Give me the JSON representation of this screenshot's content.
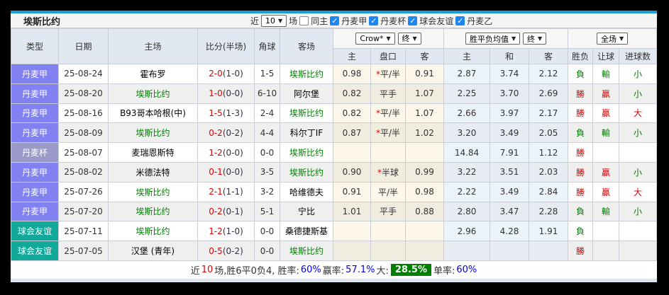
{
  "title": "埃斯比约",
  "filters": {
    "near_label": "近",
    "matches_value": "10",
    "matches_unit": "场",
    "same_home": {
      "label": "同主",
      "checked": false
    },
    "leagues": [
      {
        "label": "丹麦甲",
        "checked": true
      },
      {
        "label": "丹麦杯",
        "checked": true
      },
      {
        "label": "球会友谊",
        "checked": true
      },
      {
        "label": "丹麦乙",
        "checked": true
      }
    ]
  },
  "selectors": {
    "odds_source": "Crow*",
    "odds_time": "终",
    "avg_source": "胜平负均值",
    "avg_time": "终",
    "scope": "全场"
  },
  "columns": {
    "type": "类型",
    "date": "日期",
    "home": "主场",
    "score": "比分(半场)",
    "corner": "角球",
    "away": "客场",
    "h_home": "主",
    "h_line": "盘口",
    "h_away": "客",
    "avg_home": "主",
    "avg_draw": "和",
    "avg_away": "客",
    "res_wdl": "胜负",
    "res_handicap": "让球",
    "res_goals": "进球数"
  },
  "rows": [
    {
      "league": "丹麦甲",
      "league_class": "lg-a",
      "date": "25-08-24",
      "home": "霍布罗",
      "home_focus": false,
      "score": "2-0",
      "half": "(1-0)",
      "corner": "1-5",
      "away": "埃斯比约",
      "away_focus": true,
      "h1": "0.98",
      "star": true,
      "line": "平/半",
      "h2": "0.91",
      "a1": "2.87",
      "a2": "3.74",
      "a3": "2.12",
      "r1": "負",
      "r1c": "green",
      "r2": "輸",
      "r2c": "green",
      "r3": "小",
      "r3c": "green"
    },
    {
      "league": "丹麦甲",
      "league_class": "lg-a",
      "date": "25-08-20",
      "home": "埃斯比约",
      "home_focus": true,
      "score": "1-0",
      "half": "(0-0)",
      "corner": "6-10",
      "away": "阿尔堡",
      "away_focus": false,
      "h1": "0.82",
      "star": false,
      "line": "平手",
      "h2": "1.07",
      "a1": "2.25",
      "a2": "3.70",
      "a3": "2.69",
      "r1": "勝",
      "r1c": "red",
      "r2": "贏",
      "r2c": "red",
      "r3": "小",
      "r3c": "green"
    },
    {
      "league": "丹麦甲",
      "league_class": "lg-a",
      "date": "25-08-16",
      "home": "B93哥本哈根(中)",
      "home_focus": false,
      "score": "1-5",
      "half": "(1-3)",
      "corner": "2-4",
      "away": "埃斯比约",
      "away_focus": true,
      "h1": "0.82",
      "star": true,
      "line": "平/半",
      "h2": "1.07",
      "a1": "2.66",
      "a2": "3.97",
      "a3": "2.17",
      "r1": "勝",
      "r1c": "red",
      "r2": "贏",
      "r2c": "red",
      "r3": "大",
      "r3c": "red"
    },
    {
      "league": "丹麦甲",
      "league_class": "lg-a",
      "date": "25-08-09",
      "home": "埃斯比约",
      "home_focus": true,
      "score": "0-2",
      "half": "(0-2)",
      "corner": "4-4",
      "away": "科尔丁IF",
      "away_focus": false,
      "h1": "0.87",
      "star": true,
      "line": "平/半",
      "h2": "1.02",
      "a1": "3.20",
      "a2": "3.49",
      "a3": "2.05",
      "r1": "負",
      "r1c": "green",
      "r2": "輸",
      "r2c": "green",
      "r3": "小",
      "r3c": "green"
    },
    {
      "league": "丹麦杯",
      "league_class": "lg-cup",
      "date": "25-08-07",
      "home": "麦瑞恩斯特",
      "home_focus": false,
      "score": "1-2",
      "half": "(0-0)",
      "corner": "0-0",
      "away": "埃斯比约",
      "away_focus": true,
      "h1": "",
      "star": false,
      "line": "",
      "h2": "",
      "a1": "14.84",
      "a2": "7.91",
      "a3": "1.12",
      "r1": "勝",
      "r1c": "red",
      "r2": "",
      "r2c": "",
      "r3": "",
      "r3c": ""
    },
    {
      "league": "丹麦甲",
      "league_class": "lg-a",
      "date": "25-08-02",
      "home": "米德法特",
      "home_focus": false,
      "score": "0-1",
      "half": "(0-0)",
      "corner": "3-5",
      "away": "埃斯比约",
      "away_focus": true,
      "h1": "0.90",
      "star": true,
      "line": "半球",
      "h2": "0.99",
      "a1": "3.22",
      "a2": "3.51",
      "a3": "2.03",
      "r1": "勝",
      "r1c": "red",
      "r2": "贏",
      "r2c": "red",
      "r3": "小",
      "r3c": "green"
    },
    {
      "league": "丹麦甲",
      "league_class": "lg-a",
      "date": "25-07-26",
      "home": "埃斯比约",
      "home_focus": true,
      "score": "2-1",
      "half": "(1-1)",
      "corner": "3-2",
      "away": "哈维德夫",
      "away_focus": false,
      "h1": "0.91",
      "star": false,
      "line": "平/半",
      "h2": "0.98",
      "a1": "2.22",
      "a2": "3.49",
      "a3": "2.84",
      "r1": "勝",
      "r1c": "red",
      "r2": "贏",
      "r2c": "red",
      "r3": "大",
      "r3c": "red"
    },
    {
      "league": "丹麦甲",
      "league_class": "lg-a",
      "date": "25-07-20",
      "home": "埃斯比约",
      "home_focus": true,
      "score": "0-2",
      "half": "(0-1)",
      "corner": "5-1",
      "away": "宁比",
      "away_focus": false,
      "h1": "1.01",
      "star": false,
      "line": "平手",
      "h2": "0.88",
      "a1": "2.80",
      "a2": "3.47",
      "a3": "2.28",
      "r1": "負",
      "r1c": "green",
      "r2": "輸",
      "r2c": "green",
      "r3": "小",
      "r3c": "green"
    },
    {
      "league": "球会友谊",
      "league_class": "lg-fr",
      "date": "25-07-11",
      "home": "埃斯比约",
      "home_focus": true,
      "score": "1-2",
      "half": "(1-0)",
      "corner": "0-0",
      "away": "桑德捷斯基",
      "away_focus": false,
      "h1": "",
      "star": false,
      "line": "",
      "h2": "",
      "a1": "2.96",
      "a2": "4.28",
      "a3": "1.91",
      "r1": "負",
      "r1c": "green",
      "r2": "",
      "r2c": "",
      "r3": "",
      "r3c": ""
    },
    {
      "league": "球会友谊",
      "league_class": "lg-fr",
      "date": "25-07-05",
      "home": "汉堡 (青年)",
      "home_focus": false,
      "score": "0-5",
      "half": "(0-2)",
      "corner": "0-0",
      "away": "埃斯比约",
      "away_focus": true,
      "h1": "",
      "star": false,
      "line": "",
      "h2": "",
      "a1": "",
      "a2": "",
      "a3": "",
      "r1": "勝",
      "r1c": "red",
      "r2": "",
      "r2c": "",
      "r3": "",
      "r3c": ""
    }
  ],
  "footer": {
    "prefix": "近",
    "count": "10",
    "summary": "场,胜6平0负4, 胜率:",
    "win_rate": "60%",
    "odds_label": " 赢率:",
    "odds_rate": "57.1%",
    "big_label": " 大:",
    "big_rate": "28.5%",
    "single_label": " 单率:",
    "single_rate": "60%"
  }
}
